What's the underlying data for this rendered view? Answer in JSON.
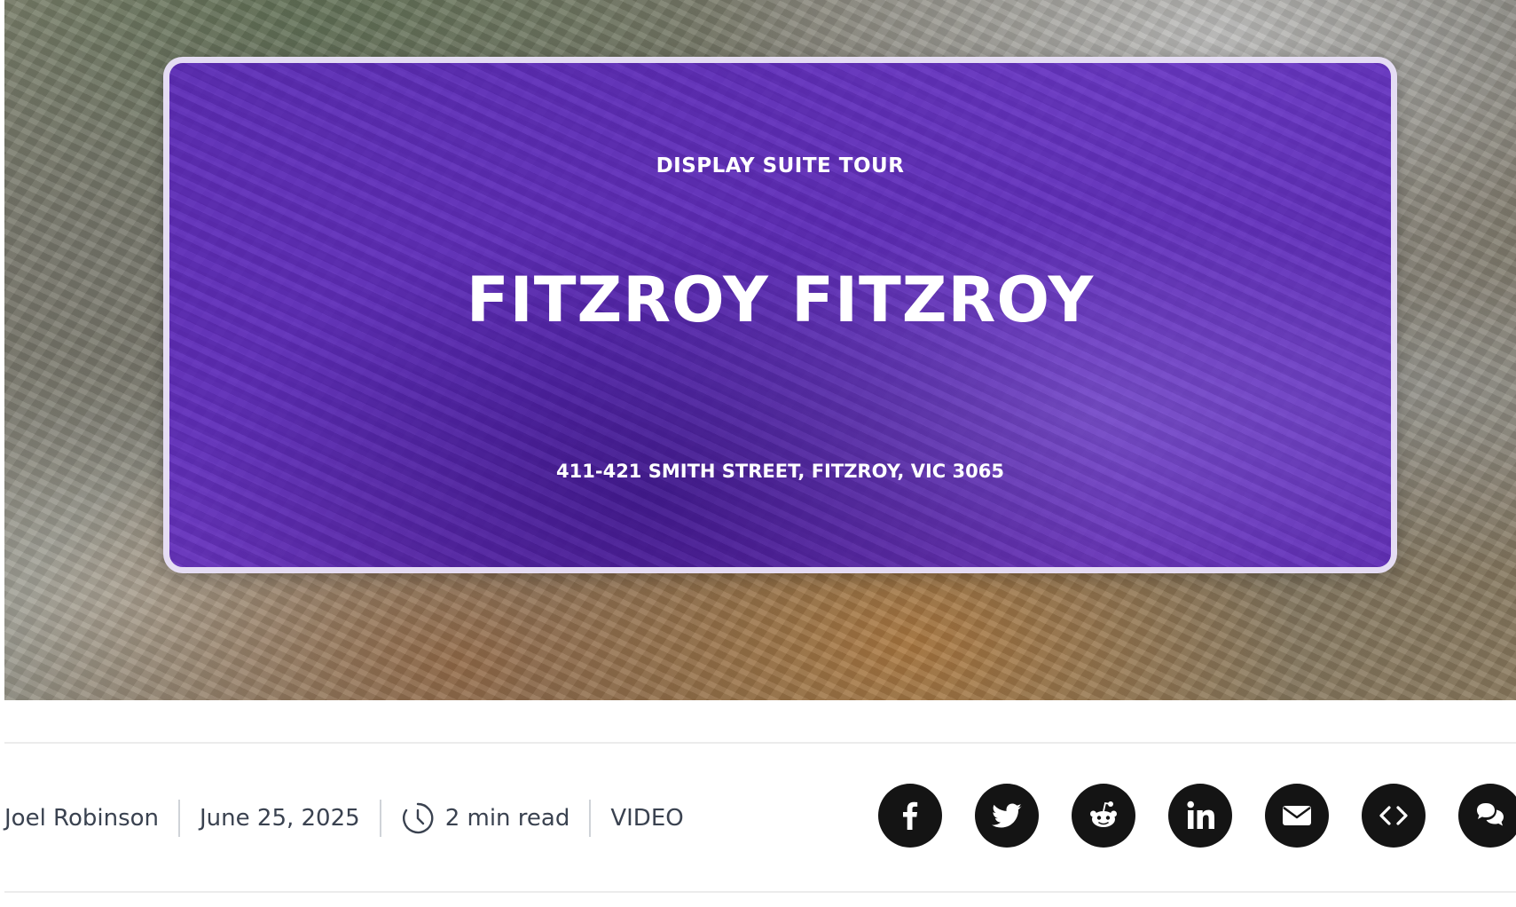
{
  "hero": {
    "eyebrow": "DISPLAY SUITE TOUR",
    "title": "FITZROY FITZROY",
    "address": "411-421 SMITH STREET, FITZROY, VIC 3065",
    "overlay_color": "#5a1ec8"
  },
  "meta": {
    "author": "Joel Robinson",
    "date": "June 25, 2025",
    "read_time": "2 min read",
    "category": "VIDEO"
  },
  "share": {
    "buttons": [
      "facebook-icon",
      "twitter-icon",
      "reddit-icon",
      "linkedin-icon",
      "email-icon",
      "embed-icon",
      "comments-icon"
    ],
    "button_color": "#141414"
  }
}
